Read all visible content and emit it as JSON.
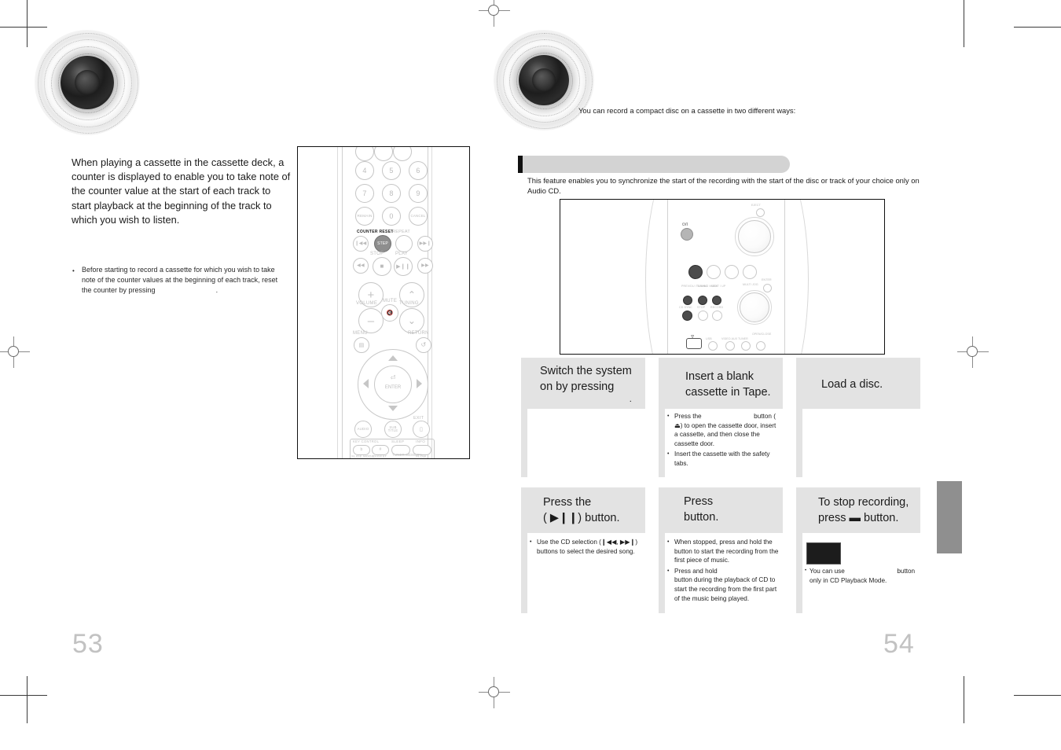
{
  "document": {
    "kind": "audio-system-user-manual-spread",
    "page_numbers": {
      "left": "53",
      "right": "54"
    }
  },
  "left_page": {
    "intro_paragraph": "When playing a cassette in the cassette deck, a counter is displayed to enable you to take note of the counter value at the start of each track to start playback at the beginning of the track to which you wish to listen.",
    "note": {
      "bullet": "•",
      "text_before_gap": "Before starting to record a cassette for which you wish to take note of the counter values at the beginning of each track, reset the counter by pressing",
      "text_after_gap": "."
    },
    "remote": {
      "caption": "",
      "keys": {
        "numbers_row2": [
          "4",
          "5",
          "6"
        ],
        "numbers_row3": [
          "7",
          "8",
          "9"
        ],
        "numbers_row4": [
          "REMAIN",
          "0",
          "CANCEL"
        ],
        "counter_reset_label": "COUNTER RESET",
        "repeat_label": "REPEAT",
        "step_label": "STEP",
        "stop_label": "STOP",
        "play_label": "PLAY",
        "volume_label": "VOLUME",
        "mute_label": "MUTE",
        "tuning_label": "TUNING",
        "menu_label": "MENU",
        "return_label": "RETURN",
        "enter_label": "ENTER",
        "audio_label": "AUDIO",
        "subtitle_label": "SUB TITLE",
        "exit_label": "EXIT",
        "key_control_label": "KEY CONTROL",
        "sleep_label": "SLEEP",
        "info_label": "INFO",
        "slide_mode_label": "SLIDE MODE",
        "digest_label": "DIGEST",
        "tuner_memory_label": "TUNER MEMORY",
        "slow_label": "SLOW",
        "key_flat": "b",
        "key_sharp": "#",
        "plus": "+",
        "minus": "–"
      }
    }
  },
  "right_page": {
    "lead_text": "You can record a compact disc on a cassette in two different ways:",
    "section_title": "",
    "section_description": "This feature enables you to synchronize the start of the recording with the start of the disc or track of your choice only on Audio CD.",
    "device": {
      "labels": {
        "eject": "EJECT",
        "power": "STANDBY/ON",
        "multi_jog": "MULTI JOG",
        "enter": "ENTER",
        "prev_down": "PREV/DU /TUNING",
        "tuning_mode": "TUNING MODE",
        "next_up": "NEXT / UP",
        "cd_sync": "CD SYNC",
        "stop": "STOP",
        "record": "RECORD",
        "tape": "TAPE",
        "tuner": "TUNER",
        "usb": "USB",
        "video_aux": "VIDEO AUX",
        "open_close": "OPEN/CLOSE"
      }
    },
    "steps": [
      {
        "id": "step-1",
        "head_lines": [
          "Switch the system",
          "on by pressing"
        ],
        "head_suffix": ".",
        "has_button_gap": true,
        "bullets": []
      },
      {
        "id": "step-2",
        "head_lines": [
          "Insert a blank",
          "cassette in Tape."
        ],
        "head_suffix": "",
        "has_button_gap": false,
        "bullets": [
          {
            "dot": "•",
            "before_gap": "Press the",
            "after_gap": "button ( ⏏)",
            "rest": "to open the cassette door, insert a cassette, and then close the cassette door."
          },
          {
            "dot": "•",
            "before_gap": "Insert the cassette with the safety tabs.",
            "after_gap": "",
            "rest": ""
          }
        ]
      },
      {
        "id": "step-3",
        "head_lines": [
          "Load a disc."
        ],
        "head_suffix": "",
        "has_button_gap": false,
        "bullets": []
      },
      {
        "id": "step-4",
        "head_lines": [
          "Press the",
          "( ▶❙❙) button."
        ],
        "head_suffix": "",
        "has_button_gap": false,
        "bullets": [
          {
            "dot": "•",
            "before_gap": "Use the CD selection (❙◀◀, ▶▶❙) buttons to select the desired song.",
            "after_gap": "",
            "rest": ""
          }
        ]
      },
      {
        "id": "step-5",
        "head_lines": [
          "Press",
          "button."
        ],
        "head_suffix": "",
        "has_button_gap": true,
        "bullets": [
          {
            "dot": "•",
            "before_gap": "When stopped, press and hold the",
            "after_gap": "",
            "rest": "button to start the recording from the first piece of music."
          },
          {
            "dot": "•",
            "before_gap": "Press and hold",
            "after_gap": "",
            "rest": "button during the playback of CD to start the recording from the first part of the music being played."
          }
        ]
      },
      {
        "id": "step-6",
        "head_lines": [
          "To stop recording,",
          "press ▬ button."
        ],
        "head_suffix": "",
        "has_button_gap": false,
        "has_black_box": true,
        "bullets": [
          {
            "dot": "•",
            "before_gap": "You can use",
            "after_gap": "button",
            "rest": "only in CD Playback Mode."
          }
        ]
      }
    ]
  },
  "colors": {
    "step_grey": "#e3e3e3",
    "section_bar": "#d3d3d3",
    "side_tab": "#8f8f8f",
    "page_number": "#c2c2c2",
    "ink": "#1b1b1b"
  }
}
